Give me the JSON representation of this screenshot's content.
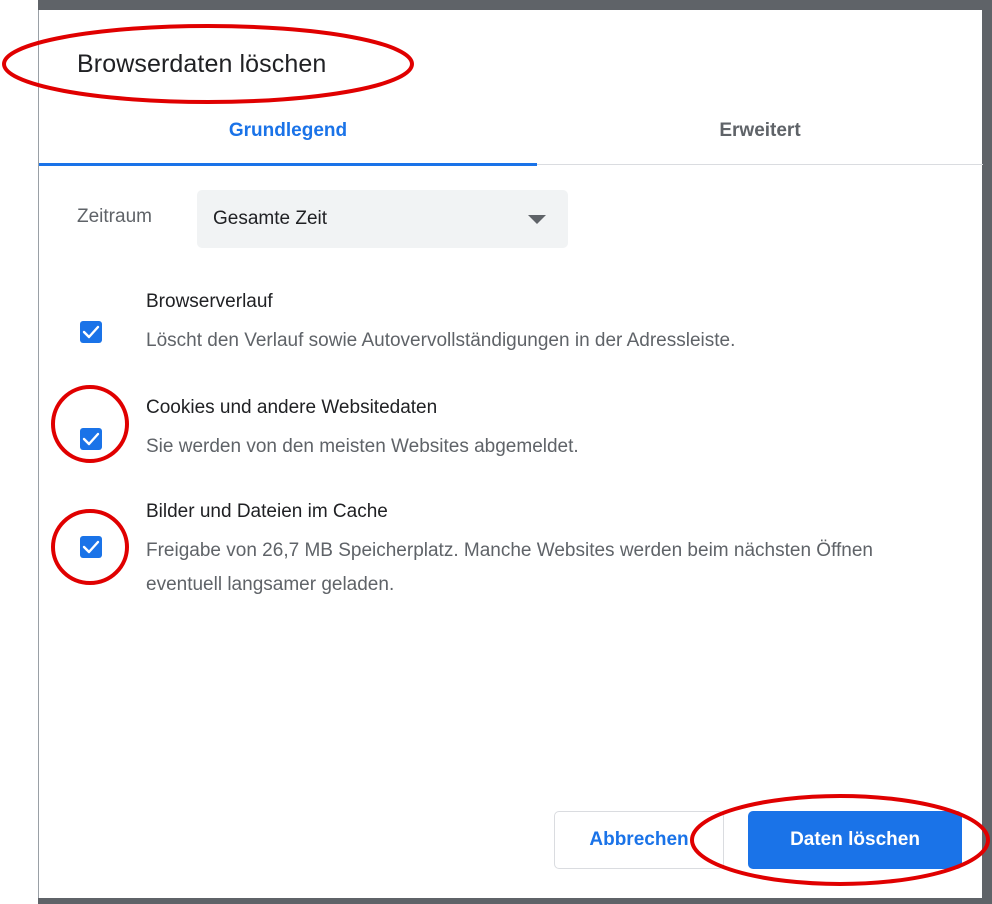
{
  "dialog": {
    "title": "Browserdaten löschen"
  },
  "tabs": [
    {
      "label": "Grundlegend",
      "active": true
    },
    {
      "label": "Erweitert",
      "active": false
    }
  ],
  "time_range": {
    "label": "Zeitraum",
    "value": "Gesamte Zeit"
  },
  "options": [
    {
      "title": "Browserverlauf",
      "description": "Löscht den Verlauf sowie Autovervollständigungen in der Adressleiste.",
      "checked": true
    },
    {
      "title": "Cookies und andere Websitedaten",
      "description": "Sie werden von den meisten Websites abgemeldet.",
      "checked": true
    },
    {
      "title": "Bilder und Dateien im Cache",
      "description": "Freigabe von 26,7 MB Speicherplatz. Manche Websites werden beim nächsten Öffnen eventuell langsamer geladen.",
      "checked": true
    }
  ],
  "buttons": {
    "cancel_label": "Abbrechen",
    "confirm_label": "Daten löschen"
  },
  "colors": {
    "accent": "#1a73e8",
    "annotation": "#e00000",
    "text_primary": "#202124",
    "text_secondary": "#5f6368"
  }
}
